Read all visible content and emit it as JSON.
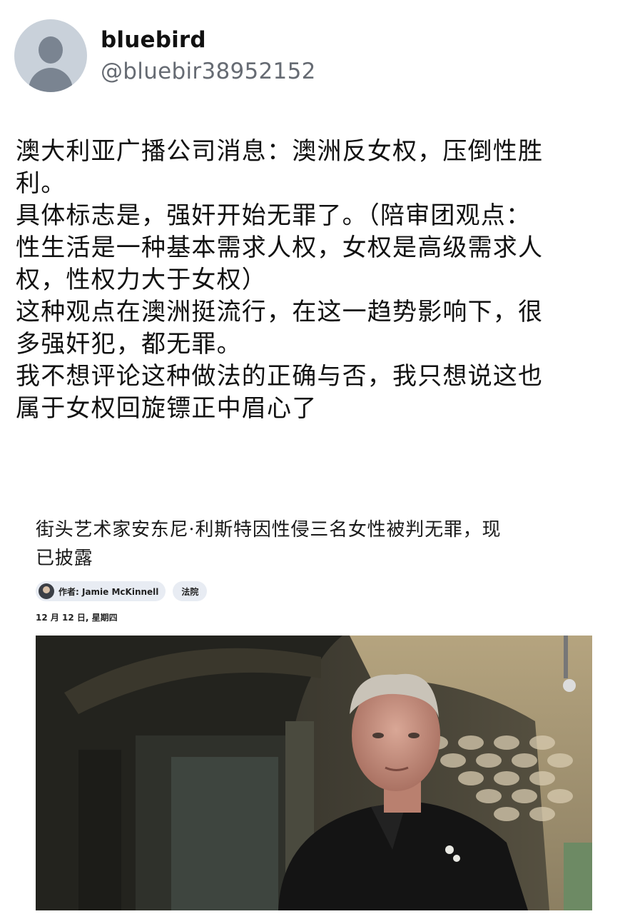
{
  "user": {
    "display_name": "bluebird",
    "handle": "@bluebir38952152"
  },
  "post": {
    "lines": [
      "澳大利亚广播公司消息：澳洲反女权，压倒性胜",
      "利。",
      "具体标志是，强奸开始无罪了。（陪审团观点：",
      "性生活是一种基本需求人权，女权是高级需求人",
      "权，性权力大于女权）",
      "这种观点在澳洲挺流行，在这一趋势影响下，很",
      "多强奸犯，都无罪。",
      "我不想评论这种做法的正确与否，我只想说这也",
      "属于女权回旋镖正中眉心了"
    ]
  },
  "article": {
    "title_lines": [
      "街头艺术家安东尼·利斯特因性侵三名女性被判无罪，现",
      "已披露"
    ],
    "author_label": "作者: Jamie McKinnell",
    "category": "法院",
    "date": "12 月 12 日, 星期四"
  },
  "icons": {
    "avatar": "default-profile-icon",
    "author_avatar": "author-avatar-icon"
  },
  "colors": {
    "handle": "#666b73",
    "pill_bg": "#e8ecf3",
    "avatar_bg": "#c9d1da"
  }
}
